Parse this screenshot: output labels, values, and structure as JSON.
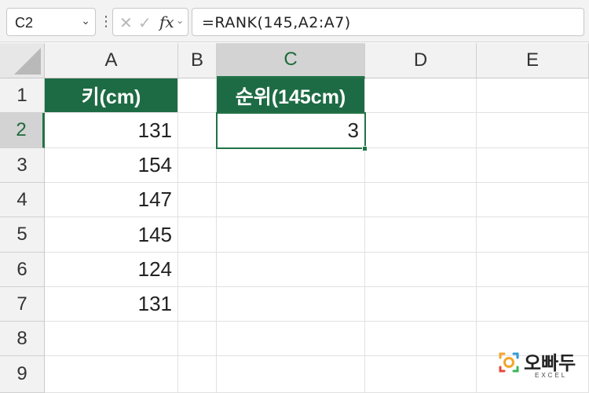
{
  "formula_bar": {
    "name_box": "C2",
    "formula": "=RANK(145,A2:A7)",
    "fx_label": "fx"
  },
  "columns": [
    "A",
    "B",
    "C",
    "D",
    "E"
  ],
  "rows": [
    "1",
    "2",
    "3",
    "4",
    "5",
    "6",
    "7",
    "8",
    "9"
  ],
  "cells": {
    "A1": "키(cm)",
    "A2": "131",
    "A3": "154",
    "A4": "147",
    "A5": "145",
    "A6": "124",
    "A7": "131",
    "C1": "순위(145cm)",
    "C2": "3"
  },
  "selection": {
    "active_cell": "C2",
    "active_column": "C",
    "active_row": "2"
  },
  "colors": {
    "header_fill": "#1d6b44",
    "selection": "#217346"
  },
  "logo": {
    "text": "오빠두",
    "sub": "EXCEL"
  }
}
